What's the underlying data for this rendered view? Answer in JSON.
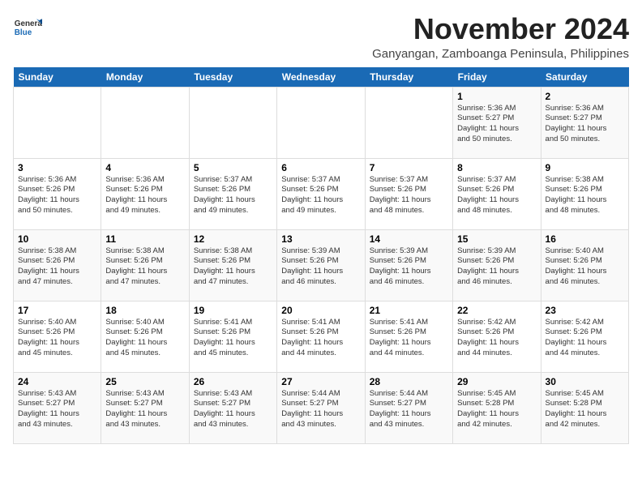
{
  "logo": {
    "general": "General",
    "blue": "Blue"
  },
  "title": "November 2024",
  "location": "Ganyangan, Zamboanga Peninsula, Philippines",
  "weekdays": [
    "Sunday",
    "Monday",
    "Tuesday",
    "Wednesday",
    "Thursday",
    "Friday",
    "Saturday"
  ],
  "weeks": [
    [
      {
        "day": "",
        "info": ""
      },
      {
        "day": "",
        "info": ""
      },
      {
        "day": "",
        "info": ""
      },
      {
        "day": "",
        "info": ""
      },
      {
        "day": "",
        "info": ""
      },
      {
        "day": "1",
        "info": "Sunrise: 5:36 AM\nSunset: 5:27 PM\nDaylight: 11 hours\nand 50 minutes."
      },
      {
        "day": "2",
        "info": "Sunrise: 5:36 AM\nSunset: 5:27 PM\nDaylight: 11 hours\nand 50 minutes."
      }
    ],
    [
      {
        "day": "3",
        "info": "Sunrise: 5:36 AM\nSunset: 5:26 PM\nDaylight: 11 hours\nand 50 minutes."
      },
      {
        "day": "4",
        "info": "Sunrise: 5:36 AM\nSunset: 5:26 PM\nDaylight: 11 hours\nand 49 minutes."
      },
      {
        "day": "5",
        "info": "Sunrise: 5:37 AM\nSunset: 5:26 PM\nDaylight: 11 hours\nand 49 minutes."
      },
      {
        "day": "6",
        "info": "Sunrise: 5:37 AM\nSunset: 5:26 PM\nDaylight: 11 hours\nand 49 minutes."
      },
      {
        "day": "7",
        "info": "Sunrise: 5:37 AM\nSunset: 5:26 PM\nDaylight: 11 hours\nand 48 minutes."
      },
      {
        "day": "8",
        "info": "Sunrise: 5:37 AM\nSunset: 5:26 PM\nDaylight: 11 hours\nand 48 minutes."
      },
      {
        "day": "9",
        "info": "Sunrise: 5:38 AM\nSunset: 5:26 PM\nDaylight: 11 hours\nand 48 minutes."
      }
    ],
    [
      {
        "day": "10",
        "info": "Sunrise: 5:38 AM\nSunset: 5:26 PM\nDaylight: 11 hours\nand 47 minutes."
      },
      {
        "day": "11",
        "info": "Sunrise: 5:38 AM\nSunset: 5:26 PM\nDaylight: 11 hours\nand 47 minutes."
      },
      {
        "day": "12",
        "info": "Sunrise: 5:38 AM\nSunset: 5:26 PM\nDaylight: 11 hours\nand 47 minutes."
      },
      {
        "day": "13",
        "info": "Sunrise: 5:39 AM\nSunset: 5:26 PM\nDaylight: 11 hours\nand 46 minutes."
      },
      {
        "day": "14",
        "info": "Sunrise: 5:39 AM\nSunset: 5:26 PM\nDaylight: 11 hours\nand 46 minutes."
      },
      {
        "day": "15",
        "info": "Sunrise: 5:39 AM\nSunset: 5:26 PM\nDaylight: 11 hours\nand 46 minutes."
      },
      {
        "day": "16",
        "info": "Sunrise: 5:40 AM\nSunset: 5:26 PM\nDaylight: 11 hours\nand 46 minutes."
      }
    ],
    [
      {
        "day": "17",
        "info": "Sunrise: 5:40 AM\nSunset: 5:26 PM\nDaylight: 11 hours\nand 45 minutes."
      },
      {
        "day": "18",
        "info": "Sunrise: 5:40 AM\nSunset: 5:26 PM\nDaylight: 11 hours\nand 45 minutes."
      },
      {
        "day": "19",
        "info": "Sunrise: 5:41 AM\nSunset: 5:26 PM\nDaylight: 11 hours\nand 45 minutes."
      },
      {
        "day": "20",
        "info": "Sunrise: 5:41 AM\nSunset: 5:26 PM\nDaylight: 11 hours\nand 44 minutes."
      },
      {
        "day": "21",
        "info": "Sunrise: 5:41 AM\nSunset: 5:26 PM\nDaylight: 11 hours\nand 44 minutes."
      },
      {
        "day": "22",
        "info": "Sunrise: 5:42 AM\nSunset: 5:26 PM\nDaylight: 11 hours\nand 44 minutes."
      },
      {
        "day": "23",
        "info": "Sunrise: 5:42 AM\nSunset: 5:26 PM\nDaylight: 11 hours\nand 44 minutes."
      }
    ],
    [
      {
        "day": "24",
        "info": "Sunrise: 5:43 AM\nSunset: 5:27 PM\nDaylight: 11 hours\nand 43 minutes."
      },
      {
        "day": "25",
        "info": "Sunrise: 5:43 AM\nSunset: 5:27 PM\nDaylight: 11 hours\nand 43 minutes."
      },
      {
        "day": "26",
        "info": "Sunrise: 5:43 AM\nSunset: 5:27 PM\nDaylight: 11 hours\nand 43 minutes."
      },
      {
        "day": "27",
        "info": "Sunrise: 5:44 AM\nSunset: 5:27 PM\nDaylight: 11 hours\nand 43 minutes."
      },
      {
        "day": "28",
        "info": "Sunrise: 5:44 AM\nSunset: 5:27 PM\nDaylight: 11 hours\nand 43 minutes."
      },
      {
        "day": "29",
        "info": "Sunrise: 5:45 AM\nSunset: 5:28 PM\nDaylight: 11 hours\nand 42 minutes."
      },
      {
        "day": "30",
        "info": "Sunrise: 5:45 AM\nSunset: 5:28 PM\nDaylight: 11 hours\nand 42 minutes."
      }
    ]
  ]
}
